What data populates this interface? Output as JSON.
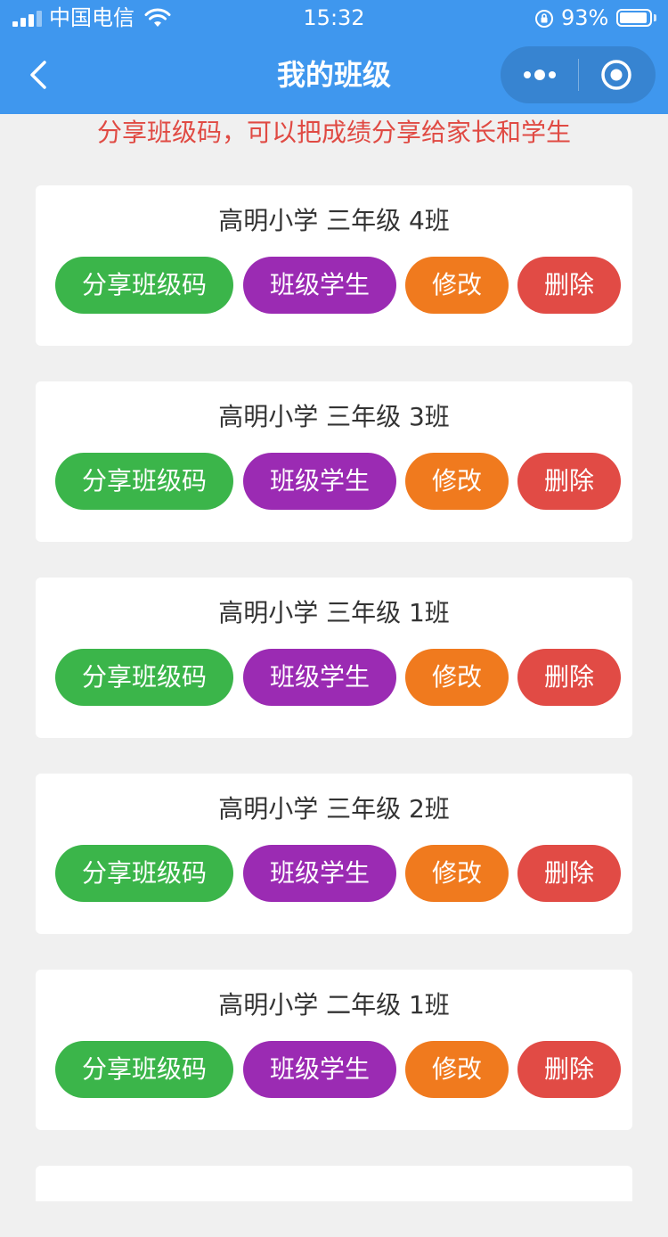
{
  "status_bar": {
    "carrier": "中国电信",
    "time": "15:32",
    "battery": "93%",
    "battery_level": 0.93
  },
  "nav": {
    "title": "我的班级"
  },
  "notice": "分享班级码，可以把成绩分享给家长和学生",
  "actions": {
    "share": "分享班级码",
    "students": "班级学生",
    "edit": "修改",
    "delete": "删除"
  },
  "classes": [
    {
      "name": "高明小学 三年级 4班"
    },
    {
      "name": "高明小学 三年级 3班"
    },
    {
      "name": "高明小学 三年级 1班"
    },
    {
      "name": "高明小学 三年级 2班"
    },
    {
      "name": "高明小学 二年级 1班"
    }
  ],
  "colors": {
    "nav_bg": "#3f97ee",
    "notice": "#e04a43",
    "share": "#3bb54a",
    "students": "#9b2bb3",
    "edit": "#f07a1e",
    "delete": "#e14b45"
  }
}
